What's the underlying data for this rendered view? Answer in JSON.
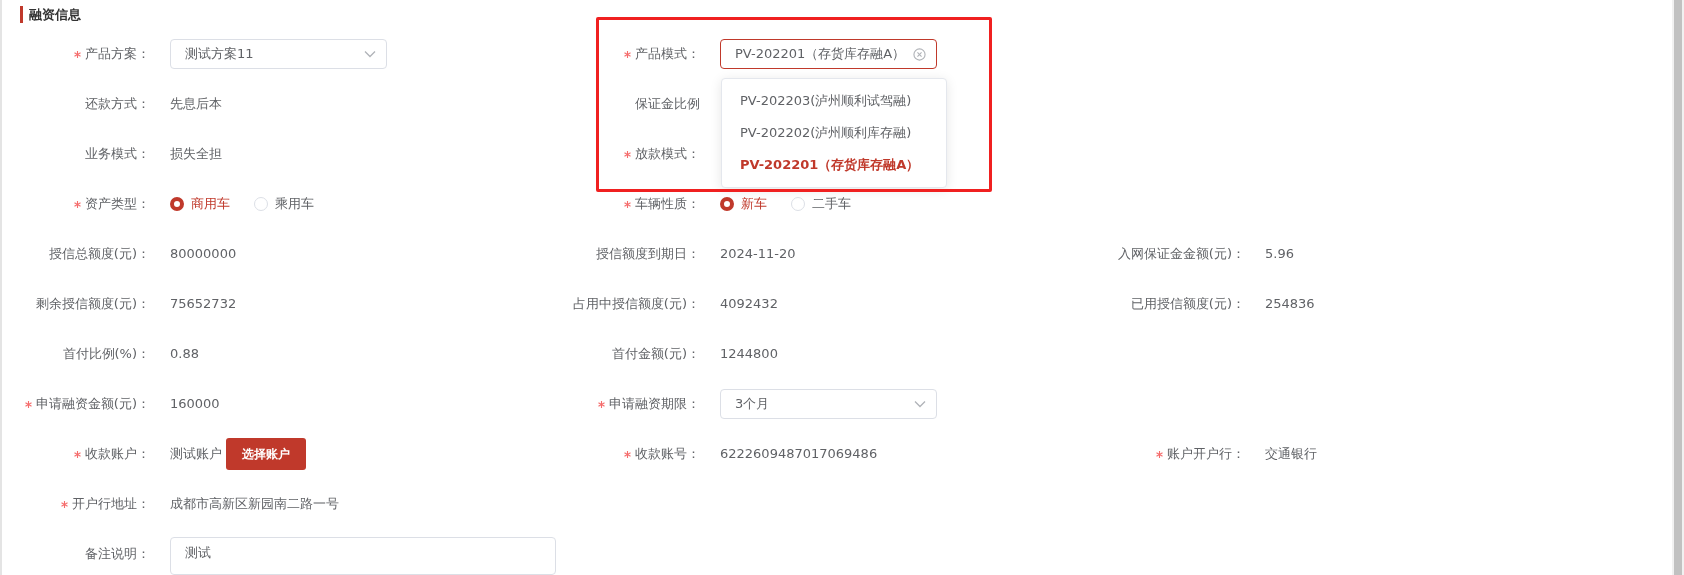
{
  "section": {
    "title": "融资信息"
  },
  "rows": [
    {
      "left": {
        "label": "产品方案：",
        "required": true,
        "kind": "select",
        "value": "测试方案11",
        "clearable": false
      },
      "middle": {
        "label": "产品模式：",
        "required": true,
        "kind": "select",
        "value": "PV-202201（存货库存融A）",
        "focused": true,
        "clearable": true,
        "expanded": true,
        "options": [
          {
            "label": "PV-202203(泸州顺利试驾融)",
            "selected": false
          },
          {
            "label": "PV-202202(泸州顺利库存融)",
            "selected": false
          },
          {
            "label": "PV-202201（存货库存融A）",
            "selected": true
          }
        ]
      }
    },
    {
      "left": {
        "label": "还款方式：",
        "required": false,
        "kind": "text",
        "value": "先息后本"
      },
      "middle": {
        "label": "保证金比例",
        "required": false,
        "kind": "label"
      }
    },
    {
      "left": {
        "label": "业务模式：",
        "required": false,
        "kind": "text",
        "value": "损失全担"
      },
      "middle": {
        "label": "放款模式：",
        "required": true,
        "kind": "label"
      }
    },
    {
      "left": {
        "label": "资产类型：",
        "required": true,
        "kind": "radio",
        "options": [
          {
            "label": "商用车",
            "selected": true
          },
          {
            "label": "乘用车",
            "selected": false
          }
        ]
      },
      "middle": {
        "label": "车辆性质：",
        "required": true,
        "kind": "radio",
        "options": [
          {
            "label": "新车",
            "selected": true
          },
          {
            "label": "二手车",
            "selected": false
          }
        ]
      }
    },
    {
      "left": {
        "label": "授信总额度(元)：",
        "required": false,
        "kind": "text",
        "value": "80000000"
      },
      "middle": {
        "label": "授信额度到期日：",
        "required": false,
        "kind": "text",
        "value": "2024-11-20"
      },
      "right": {
        "label": "入网保证金金额(元)：",
        "required": false,
        "kind": "text",
        "value": "5.96"
      }
    },
    {
      "left": {
        "label": "剩余授信额度(元)：",
        "required": false,
        "kind": "text",
        "value": "75652732"
      },
      "middle": {
        "label": "占用中授信额度(元)：",
        "required": false,
        "kind": "text",
        "value": "4092432"
      },
      "right": {
        "label": "已用授信额度(元)：",
        "required": false,
        "kind": "text",
        "value": "254836"
      }
    },
    {
      "left": {
        "label": "首付比例(%)：",
        "required": false,
        "kind": "text",
        "value": "0.88"
      },
      "middle": {
        "label": "首付金额(元)：",
        "required": false,
        "kind": "text",
        "value": "1244800"
      }
    },
    {
      "left": {
        "label": "申请融资金额(元)：",
        "required": true,
        "kind": "text",
        "value": "160000"
      },
      "middle": {
        "label": "申请融资期限：",
        "required": true,
        "kind": "select",
        "value": "3个月",
        "clearable": false
      }
    },
    {
      "left": {
        "label": "收款账户：",
        "required": true,
        "kind": "account",
        "value": "测试账户",
        "button": "选择账户"
      },
      "middle": {
        "label": "收款账号：",
        "required": true,
        "kind": "text",
        "value": "6222609487017069486"
      },
      "right": {
        "label": "账户开户行：",
        "required": true,
        "kind": "text",
        "value": "交通银行"
      }
    },
    {
      "left": {
        "label": "开户行地址：",
        "required": true,
        "kind": "text",
        "value": "成都市高新区新园南二路一号"
      }
    },
    {
      "left": {
        "label": "备注说明：",
        "required": false,
        "kind": "textarea",
        "value": "测试"
      }
    }
  ]
}
